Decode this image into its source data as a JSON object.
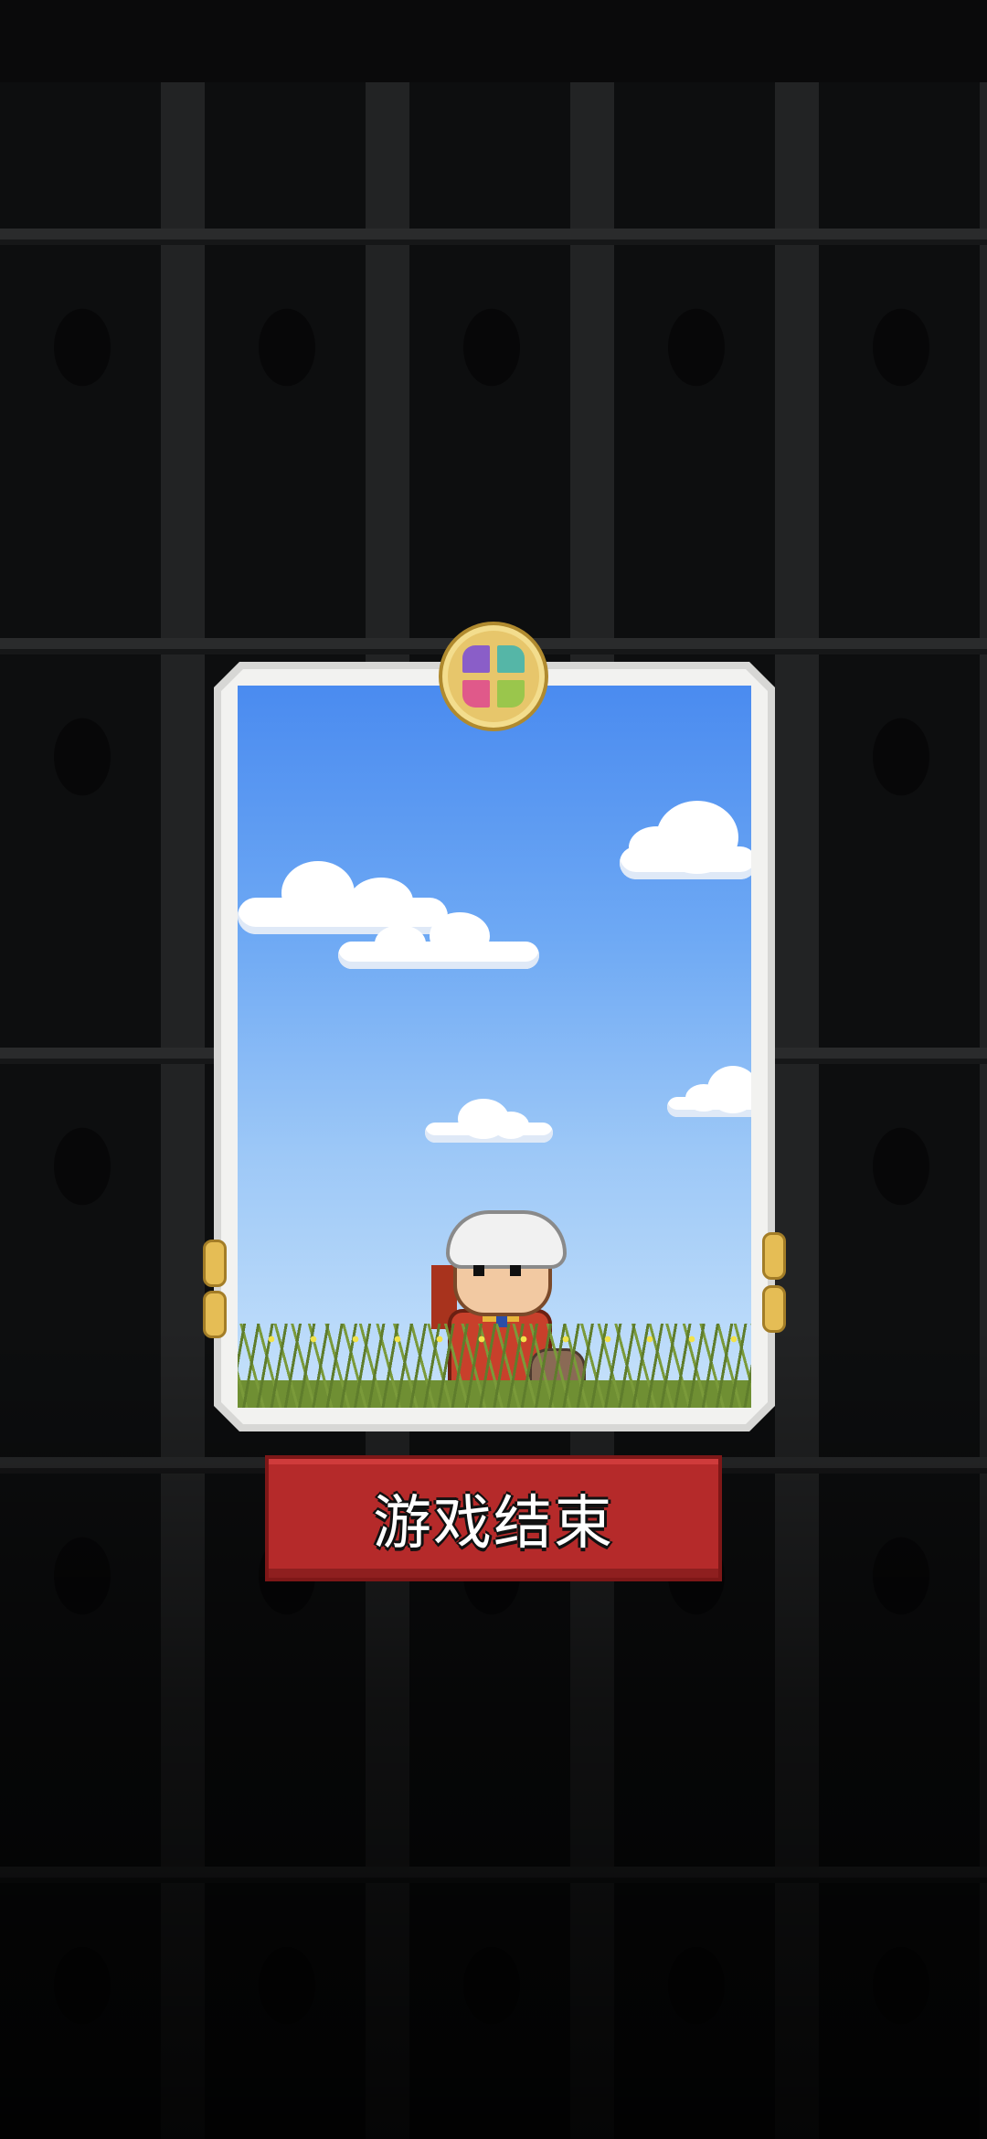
{
  "screen": {
    "name": "game-over",
    "background_theme": "dark-gothic-arches",
    "colors": {
      "background": "#0b0b0c",
      "sky_top": "#4a8bf0",
      "sky_bottom": "#c7e2fb",
      "card_frame": "#d7d7d5",
      "button_red": "#b52a2a",
      "gold": "#e5bd55"
    }
  },
  "card": {
    "scene": "sky-with-clouds-and-grass",
    "character": "old-king-with-cape",
    "top_gem_icon": "four-color-gem-icon"
  },
  "actions": {
    "game_over_label": "游戏结束"
  }
}
